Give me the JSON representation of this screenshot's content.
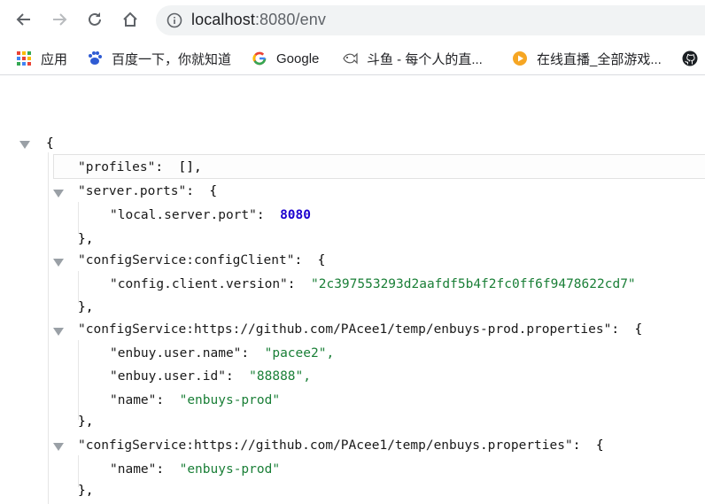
{
  "browser": {
    "url_host": "localhost",
    "url_rest": ":8080/env",
    "bookmarks": [
      {
        "icon": "apps-grid-icon",
        "label": "应用"
      },
      {
        "icon": "baidu-paw-icon",
        "label": "百度一下，你就知道"
      },
      {
        "icon": "google-g-icon",
        "label": "Google"
      },
      {
        "icon": "douyu-fish-icon",
        "label": "斗鱼 - 每个人的直..."
      },
      {
        "icon": "live-play-icon",
        "label": "在线直播_全部游戏..."
      },
      {
        "icon": "github-icon",
        "label": ""
      }
    ]
  },
  "json_view": {
    "open_brace": "{",
    "profiles_key": "\"profiles\"",
    "profiles_val": "[],",
    "server_ports_key": "\"server.ports\"",
    "local_server_port_key": "\"local.server.port\"",
    "local_server_port_val": "8080",
    "close_brace_comma": "},",
    "config_client_key": "\"configService:configClient\"",
    "config_client_version_key": "\"config.client.version\"",
    "config_client_version_val": "\"2c397553293d2aafdf5b4f2fc0ff6f9478622cd7\"",
    "prod_props_key": "\"configService:https://github.com/PAcee1/temp/enbuys-prod.properties\"",
    "enbuy_user_name_key": "\"enbuy.user.name\"",
    "enbuy_user_name_val": "\"pacee2\",",
    "enbuy_user_id_key": "\"enbuy.user.id\"",
    "enbuy_user_id_val": "\"88888\",",
    "name_key": "\"name\"",
    "name_val_prod": "\"enbuys-prod\"",
    "props_key": "\"configService:https://github.com/PAcee1/temp/enbuys.properties\"",
    "name_val_2": "\"enbuys-prod\""
  }
}
